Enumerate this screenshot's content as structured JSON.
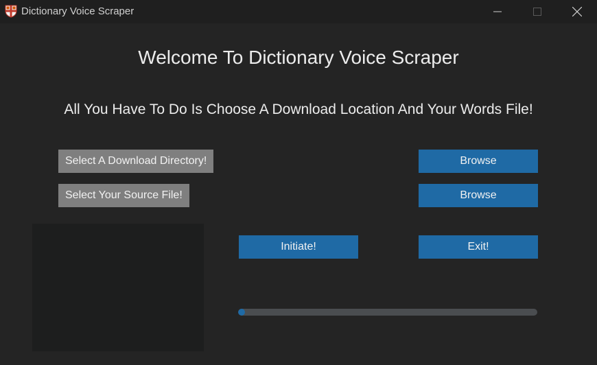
{
  "window": {
    "title": "Dictionary Voice Scraper",
    "app_icon": "shield-crest-icon",
    "controls": [
      "minimize-icon",
      "maximize-icon",
      "close-icon"
    ]
  },
  "main": {
    "heading": "Welcome To Dictionary Voice Scraper",
    "subheading": "All You Have To Do Is Choose A Download Location And Your Words File!",
    "download_label": "Select A Download Directory!",
    "source_label": "Select Your Source File!",
    "browse_download_label": "Browse",
    "browse_source_label": "Browse",
    "initiate_label": "Initiate!",
    "exit_label": "Exit!",
    "progress": 0.02
  },
  "colors": {
    "background": "#242424",
    "titlebar": "#1f1f1f",
    "accent": "#1f6aa5",
    "label_bg": "#7f7f7f",
    "textbox_bg": "#1d1e1e",
    "progress_track": "#4a4d50"
  }
}
